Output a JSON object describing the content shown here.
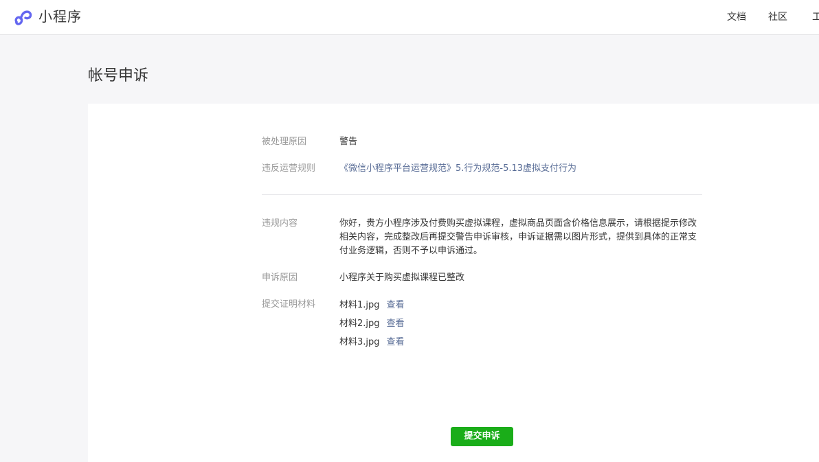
{
  "header": {
    "brand": "小程序",
    "nav": {
      "docs": "文档",
      "community": "社区",
      "tools": "工具"
    }
  },
  "page": {
    "title": "帐号申诉"
  },
  "details": {
    "reason_label": "被处理原因",
    "reason_value": "警告",
    "rule_label": "违反运营规则",
    "rule_value": "《微信小程序平台运营规范》5.行为规范-5.13虚拟支付行为",
    "content_label": "违规内容",
    "content_value": "你好，贵方小程序涉及付费购买虚拟课程，虚拟商品页面含价格信息展示，请根据提示修改相关内容，完成整改后再提交警告申诉审核，申诉证据需以图片形式，提供到具体的正常支付业务逻辑，否则不予以申诉通过。",
    "appeal_reason_label": "申诉原因",
    "appeal_reason_value": "小程序关于购买虚拟课程已整改",
    "materials_label": "提交证明材料",
    "materials": [
      {
        "name": "材料1.jpg",
        "action": "查看"
      },
      {
        "name": "材料2.jpg",
        "action": "查看"
      },
      {
        "name": "材料3.jpg",
        "action": "查看"
      }
    ]
  },
  "actions": {
    "submit_label": "提交申诉"
  },
  "colors": {
    "brand_icon": "#6467f0",
    "link": "#576b95",
    "primary_button": "#1aad19"
  }
}
